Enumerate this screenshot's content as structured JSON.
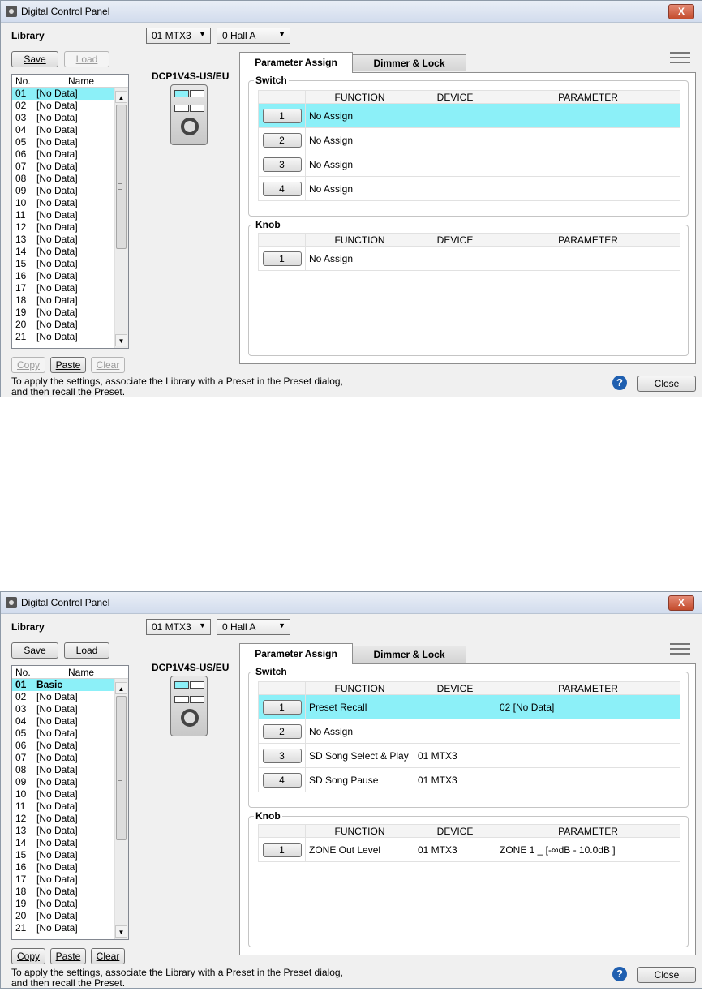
{
  "dialogs": [
    {
      "window_title": "Digital Control Panel",
      "close_glyph": "X",
      "library_label": "Library",
      "device_select": "01 MTX3",
      "preset_select": "0 Hall A",
      "save_label": "Save",
      "load_label": "Load",
      "load_enabled": false,
      "list_header": {
        "no": "No.",
        "name": "Name"
      },
      "list_rows": [
        {
          "no": "01",
          "name": "[No Data]"
        },
        {
          "no": "02",
          "name": "[No Data]"
        },
        {
          "no": "03",
          "name": "[No Data]"
        },
        {
          "no": "04",
          "name": "[No Data]"
        },
        {
          "no": "05",
          "name": "[No Data]"
        },
        {
          "no": "06",
          "name": "[No Data]"
        },
        {
          "no": "07",
          "name": "[No Data]"
        },
        {
          "no": "08",
          "name": "[No Data]"
        },
        {
          "no": "09",
          "name": "[No Data]"
        },
        {
          "no": "10",
          "name": "[No Data]"
        },
        {
          "no": "11",
          "name": "[No Data]"
        },
        {
          "no": "12",
          "name": "[No Data]"
        },
        {
          "no": "13",
          "name": "[No Data]"
        },
        {
          "no": "14",
          "name": "[No Data]"
        },
        {
          "no": "15",
          "name": "[No Data]"
        },
        {
          "no": "16",
          "name": "[No Data]"
        },
        {
          "no": "17",
          "name": "[No Data]"
        },
        {
          "no": "18",
          "name": "[No Data]"
        },
        {
          "no": "19",
          "name": "[No Data]"
        },
        {
          "no": "20",
          "name": "[No Data]"
        },
        {
          "no": "21",
          "name": "[No Data]"
        }
      ],
      "selected_row": 0,
      "selected_bold": false,
      "copy_label": "Copy",
      "paste_label": "Paste",
      "clear_label": "Clear",
      "copy_enabled": false,
      "clear_enabled": false,
      "device_model": "DCP1V4S-US/EU",
      "tab_param": "Parameter Assign",
      "tab_dimmer": "Dimmer & Lock",
      "switch_label": "Switch",
      "knob_label": "Knob",
      "col_function": "FUNCTION",
      "col_device": "DEVICE",
      "col_parameter": "PARAMETER",
      "switches": [
        {
          "num": "1",
          "function": "No Assign",
          "device": "",
          "parameter": ""
        },
        {
          "num": "2",
          "function": "No Assign",
          "device": "",
          "parameter": ""
        },
        {
          "num": "3",
          "function": "No Assign",
          "device": "",
          "parameter": ""
        },
        {
          "num": "4",
          "function": "No Assign",
          "device": "",
          "parameter": ""
        }
      ],
      "knobs": [
        {
          "num": "1",
          "function": "No Assign",
          "device": "",
          "parameter": ""
        }
      ],
      "hint_line1": "To apply the settings, associate the Library with a Preset in the Preset dialog,",
      "hint_line2": "and then recall the Preset.",
      "help_glyph": "?",
      "close_label": "Close"
    },
    {
      "window_title": "Digital Control Panel",
      "close_glyph": "X",
      "library_label": "Library",
      "device_select": "01 MTX3",
      "preset_select": "0 Hall A",
      "save_label": "Save",
      "load_label": "Load",
      "load_enabled": true,
      "list_header": {
        "no": "No.",
        "name": "Name"
      },
      "list_rows": [
        {
          "no": "01",
          "name": "Basic"
        },
        {
          "no": "02",
          "name": "[No Data]"
        },
        {
          "no": "03",
          "name": "[No Data]"
        },
        {
          "no": "04",
          "name": "[No Data]"
        },
        {
          "no": "05",
          "name": "[No Data]"
        },
        {
          "no": "06",
          "name": "[No Data]"
        },
        {
          "no": "07",
          "name": "[No Data]"
        },
        {
          "no": "08",
          "name": "[No Data]"
        },
        {
          "no": "09",
          "name": "[No Data]"
        },
        {
          "no": "10",
          "name": "[No Data]"
        },
        {
          "no": "11",
          "name": "[No Data]"
        },
        {
          "no": "12",
          "name": "[No Data]"
        },
        {
          "no": "13",
          "name": "[No Data]"
        },
        {
          "no": "14",
          "name": "[No Data]"
        },
        {
          "no": "15",
          "name": "[No Data]"
        },
        {
          "no": "16",
          "name": "[No Data]"
        },
        {
          "no": "17",
          "name": "[No Data]"
        },
        {
          "no": "18",
          "name": "[No Data]"
        },
        {
          "no": "19",
          "name": "[No Data]"
        },
        {
          "no": "20",
          "name": "[No Data]"
        },
        {
          "no": "21",
          "name": "[No Data]"
        }
      ],
      "selected_row": 0,
      "selected_bold": true,
      "copy_label": "Copy",
      "paste_label": "Paste",
      "clear_label": "Clear",
      "copy_enabled": true,
      "clear_enabled": true,
      "device_model": "DCP1V4S-US/EU",
      "tab_param": "Parameter Assign",
      "tab_dimmer": "Dimmer & Lock",
      "switch_label": "Switch",
      "knob_label": "Knob",
      "col_function": "FUNCTION",
      "col_device": "DEVICE",
      "col_parameter": "PARAMETER",
      "switches": [
        {
          "num": "1",
          "function": "Preset Recall",
          "device": "",
          "parameter": "02 [No Data]"
        },
        {
          "num": "2",
          "function": "No Assign",
          "device": "",
          "parameter": ""
        },
        {
          "num": "3",
          "function": "SD Song Select & Play",
          "device": "01 MTX3",
          "parameter": ""
        },
        {
          "num": "4",
          "function": "SD Song Pause",
          "device": "01 MTX3",
          "parameter": ""
        }
      ],
      "knobs": [
        {
          "num": "1",
          "function": "ZONE Out Level",
          "device": "01 MTX3",
          "parameter": "ZONE 1 _ [-∞dB - 10.0dB ]"
        }
      ],
      "hint_line1": "To apply the settings, associate the Library with a Preset in the Preset dialog,",
      "hint_line2": "and then recall the Preset.",
      "help_glyph": "?",
      "close_label": "Close"
    }
  ],
  "colors": {
    "selection": "#8cf0f8",
    "help_icon": "#1f5fb0"
  }
}
